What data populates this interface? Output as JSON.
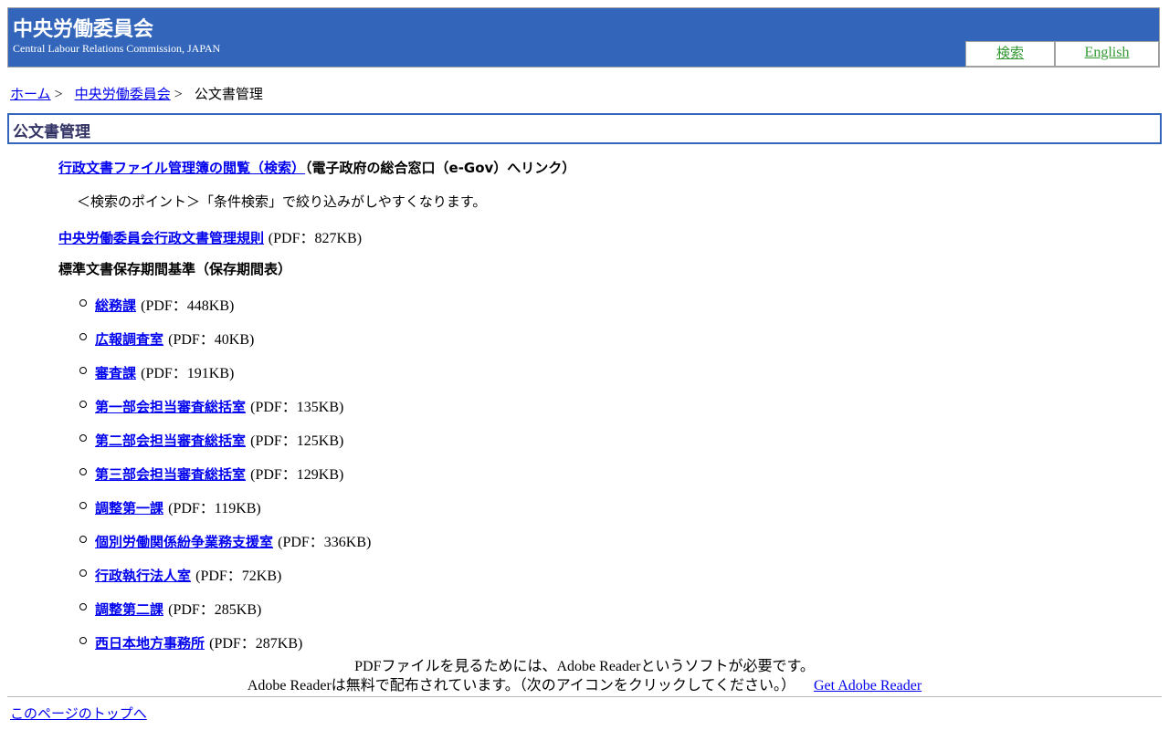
{
  "header": {
    "title": "中央労働委員会",
    "subtitle": "Central Labour Relations Commission, JAPAN",
    "links": {
      "search": "検索",
      "english": "English"
    }
  },
  "breadcrumb": {
    "home": "ホーム",
    "parent": "中央労働委員会",
    "separator": ">",
    "current": "公文書管理"
  },
  "page_title": "公文書管理",
  "content": {
    "egov_link": "行政文書ファイル管理簿の閲覧（検索）",
    "egov_note": "（電子政府の総合窓口（e-Gov）へリンク）",
    "search_tip": "＜検索のポイント＞「条件検索」で絞り込みがしやすくなります。",
    "rules_link": "中央労働委員会行政文書管理規則",
    "rules_size": "(PDF：827KB)",
    "standard_heading": "標準文書保存期間基準（保存期間表）",
    "departments": [
      {
        "name": "総務課",
        "size": "(PDF：448KB)"
      },
      {
        "name": "広報調査室",
        "size": "(PDF：40KB)"
      },
      {
        "name": "審査課",
        "size": "(PDF：191KB)"
      },
      {
        "name": "第一部会担当審査総括室",
        "size": "(PDF：135KB)"
      },
      {
        "name": "第二部会担当審査総括室",
        "size": "(PDF：125KB)"
      },
      {
        "name": "第三部会担当審査総括室",
        "size": "(PDF：129KB)"
      },
      {
        "name": "調整第一課",
        "size": "(PDF：119KB)"
      },
      {
        "name": "個別労働関係紛争業務支援室",
        "size": "(PDF：336KB)"
      },
      {
        "name": "行政執行法人室",
        "size": "(PDF：72KB)"
      },
      {
        "name": "調整第二課",
        "size": "(PDF：285KB)"
      },
      {
        "name": "西日本地方事務所",
        "size": "(PDF：287KB)"
      }
    ]
  },
  "adobe": {
    "line1": "PDFファイルを見るためには、Adobe Readerというソフトが必要です。",
    "line2": "Adobe Readerは無料で配布されています。（次のアイコンをクリックしてください。）",
    "link": "Get Adobe Reader"
  },
  "footer": {
    "page_top": "このページのトップへ"
  },
  "colors": {
    "header_bg": "#3366bb",
    "link": "#0000ee",
    "header_link": "#339933",
    "title_border": "#3366bb"
  }
}
